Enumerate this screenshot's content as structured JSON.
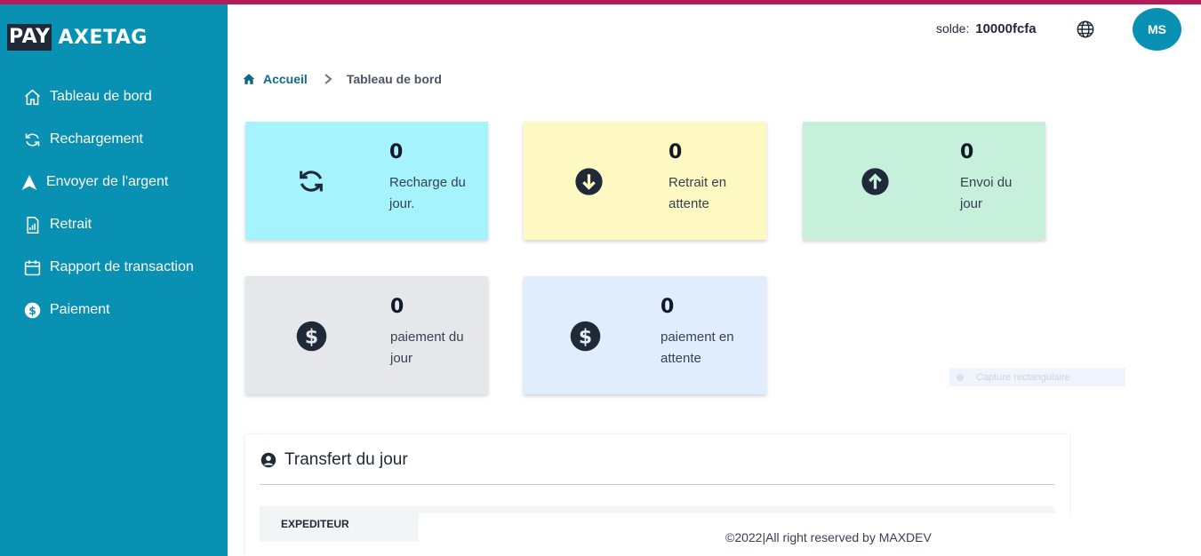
{
  "brand": {
    "part1": "PAY",
    "part2": "AXETAG"
  },
  "sidebar": {
    "items": [
      {
        "label": "Tableau de bord",
        "icon": "home-icon"
      },
      {
        "label": "Rechargement",
        "icon": "refresh-icon"
      },
      {
        "label": "Envoyer de l'argent",
        "icon": "send-icon"
      },
      {
        "label": "Retrait",
        "icon": "withdraw-icon"
      },
      {
        "label": "Rapport de transaction",
        "icon": "calendar-icon"
      },
      {
        "label": "Paiement",
        "icon": "dollar-icon"
      }
    ]
  },
  "header": {
    "balance_label": "solde:",
    "balance_value": "10000fcfa",
    "language_icon": "globe-icon",
    "avatar_initials": "MS"
  },
  "breadcrumb": {
    "home": "Accueil",
    "current": "Tableau de bord"
  },
  "cards": [
    {
      "value": "0",
      "label": "Recharge du jour.",
      "icon": "refresh-icon",
      "bg": "#a5f3fc"
    },
    {
      "value": "0",
      "label": "Retrait en attente",
      "icon": "arrow-down-circle-icon",
      "bg": "#fef9c3"
    },
    {
      "value": "0",
      "label": "Envoi du jour",
      "icon": "arrow-up-circle-icon",
      "bg": "#c6efdc"
    },
    {
      "value": "0",
      "label": "paiement du jour",
      "icon": "dollar-circle-icon",
      "bg": "#e5e7eb"
    },
    {
      "value": "0",
      "label": "paiement en attente",
      "icon": "dollar-circle-icon",
      "bg": "#e0edfc"
    }
  ],
  "transfer": {
    "title": "Transfert du jour",
    "columns": [
      "EXPEDITEUR"
    ]
  },
  "overlay": {
    "capture_label": "Capture rectangulaire"
  },
  "footer": {
    "text": "©2022|All right reserved by MAXDEV"
  },
  "colors": {
    "primary": "#0891b2",
    "top_accent": "#b31b5a",
    "dark": "#1f2937"
  }
}
